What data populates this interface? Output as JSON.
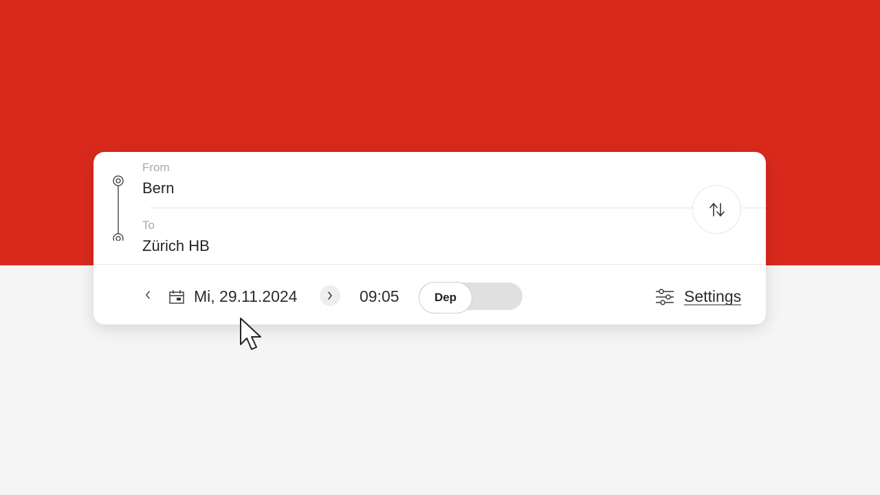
{
  "from": {
    "label": "From",
    "value": "Bern"
  },
  "to": {
    "label": "To",
    "value": "Zürich HB"
  },
  "date": {
    "text": "Mi, 29.11.2024"
  },
  "time": {
    "text": "09:05"
  },
  "mode_toggle": {
    "selected": "Dep"
  },
  "settings": {
    "label": "Settings"
  },
  "colors": {
    "brand_red": "#d9291c",
    "background": "#f5f5f5",
    "card": "#ffffff"
  },
  "icons": [
    "route-track-icon",
    "swap-direction-icon",
    "chevron-left-icon",
    "calendar-icon",
    "chevron-right-icon",
    "sliders-icon",
    "mouse-cursor-icon"
  ]
}
